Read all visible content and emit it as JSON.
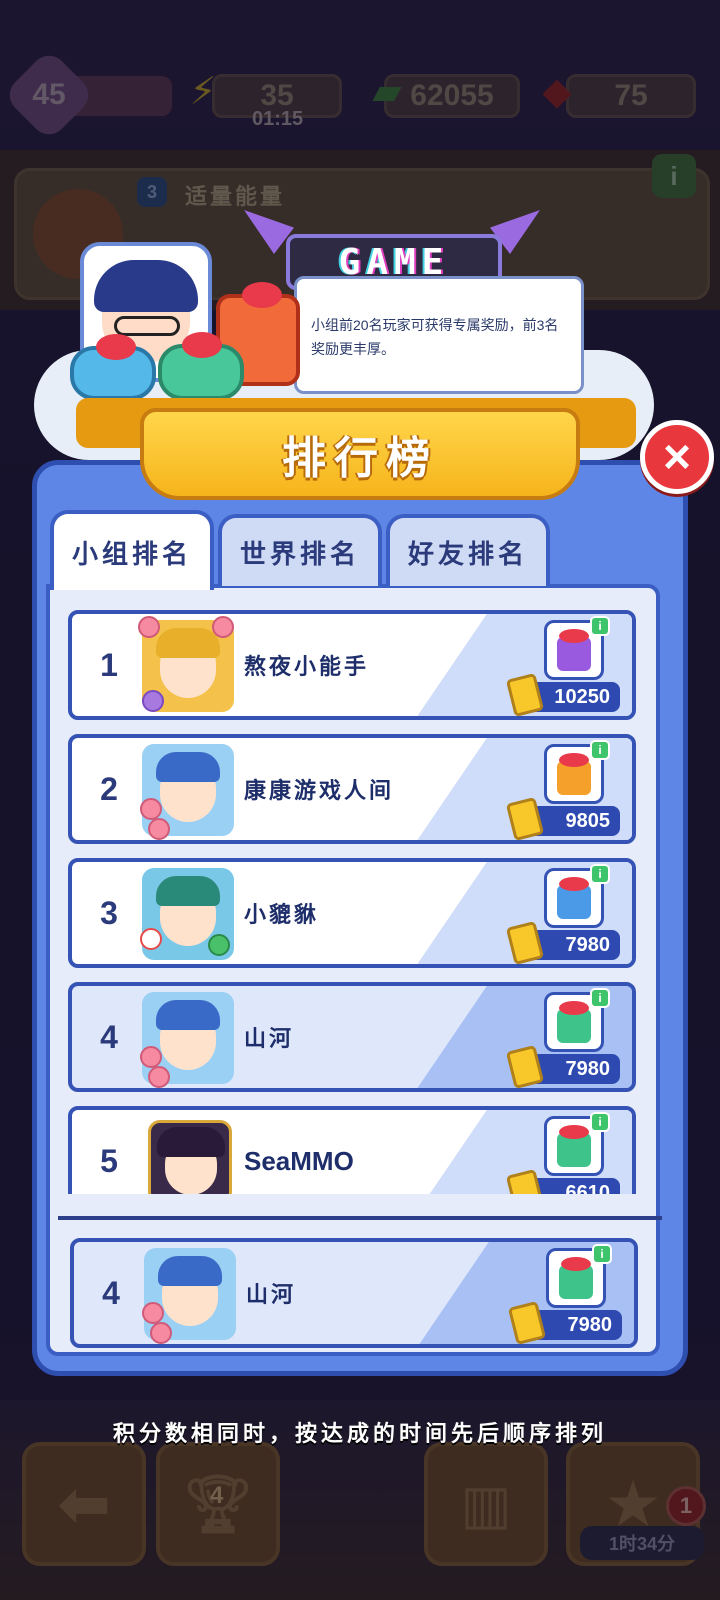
{
  "hud": {
    "level": "45",
    "energy": "35",
    "energy_timer": "01:15",
    "cash": "62055",
    "gems": "75",
    "card_title": "适量能量",
    "card_badge": "3"
  },
  "popup": {
    "sign_text": "GAME",
    "info_text": "小组前20名玩家可获得专属奖励，前3名奖励更丰厚。",
    "title": "排行榜",
    "close_icon": "×",
    "tabs": [
      {
        "label": "小组排名",
        "active": true
      },
      {
        "label": "世界排名",
        "active": false
      },
      {
        "label": "好友排名",
        "active": false
      }
    ],
    "rows": [
      {
        "rank": "1",
        "name": "熬夜小能手",
        "score": "10250",
        "gift_color": "#9a5ae0"
      },
      {
        "rank": "2",
        "name": "康康游戏人间",
        "score": "9805",
        "gift_color": "#f5a02a"
      },
      {
        "rank": "3",
        "name": "小貔貅",
        "score": "7980",
        "gift_color": "#4a9ae8"
      },
      {
        "rank": "4",
        "name": "山河",
        "score": "7980",
        "gift_color": "#3ec48a"
      },
      {
        "rank": "5",
        "name": "SeaMMO",
        "score": "6610",
        "gift_color": "#3ec48a"
      }
    ],
    "self_row": {
      "rank": "4",
      "name": "山河",
      "score": "7980",
      "gift_color": "#3ec48a"
    },
    "footnote": "积分数相同时，按达成的时间先后顺序排列"
  },
  "bottom_nav": {
    "trophy_count": "4",
    "notification_badge": "1",
    "timer": "1时34分"
  },
  "colors": {
    "panel": "#5e86e6",
    "panel_border": "#2e4fb0",
    "ribbon": "#f6b41c",
    "close": "#e8383e",
    "score_pill": "#2e4ab0"
  }
}
